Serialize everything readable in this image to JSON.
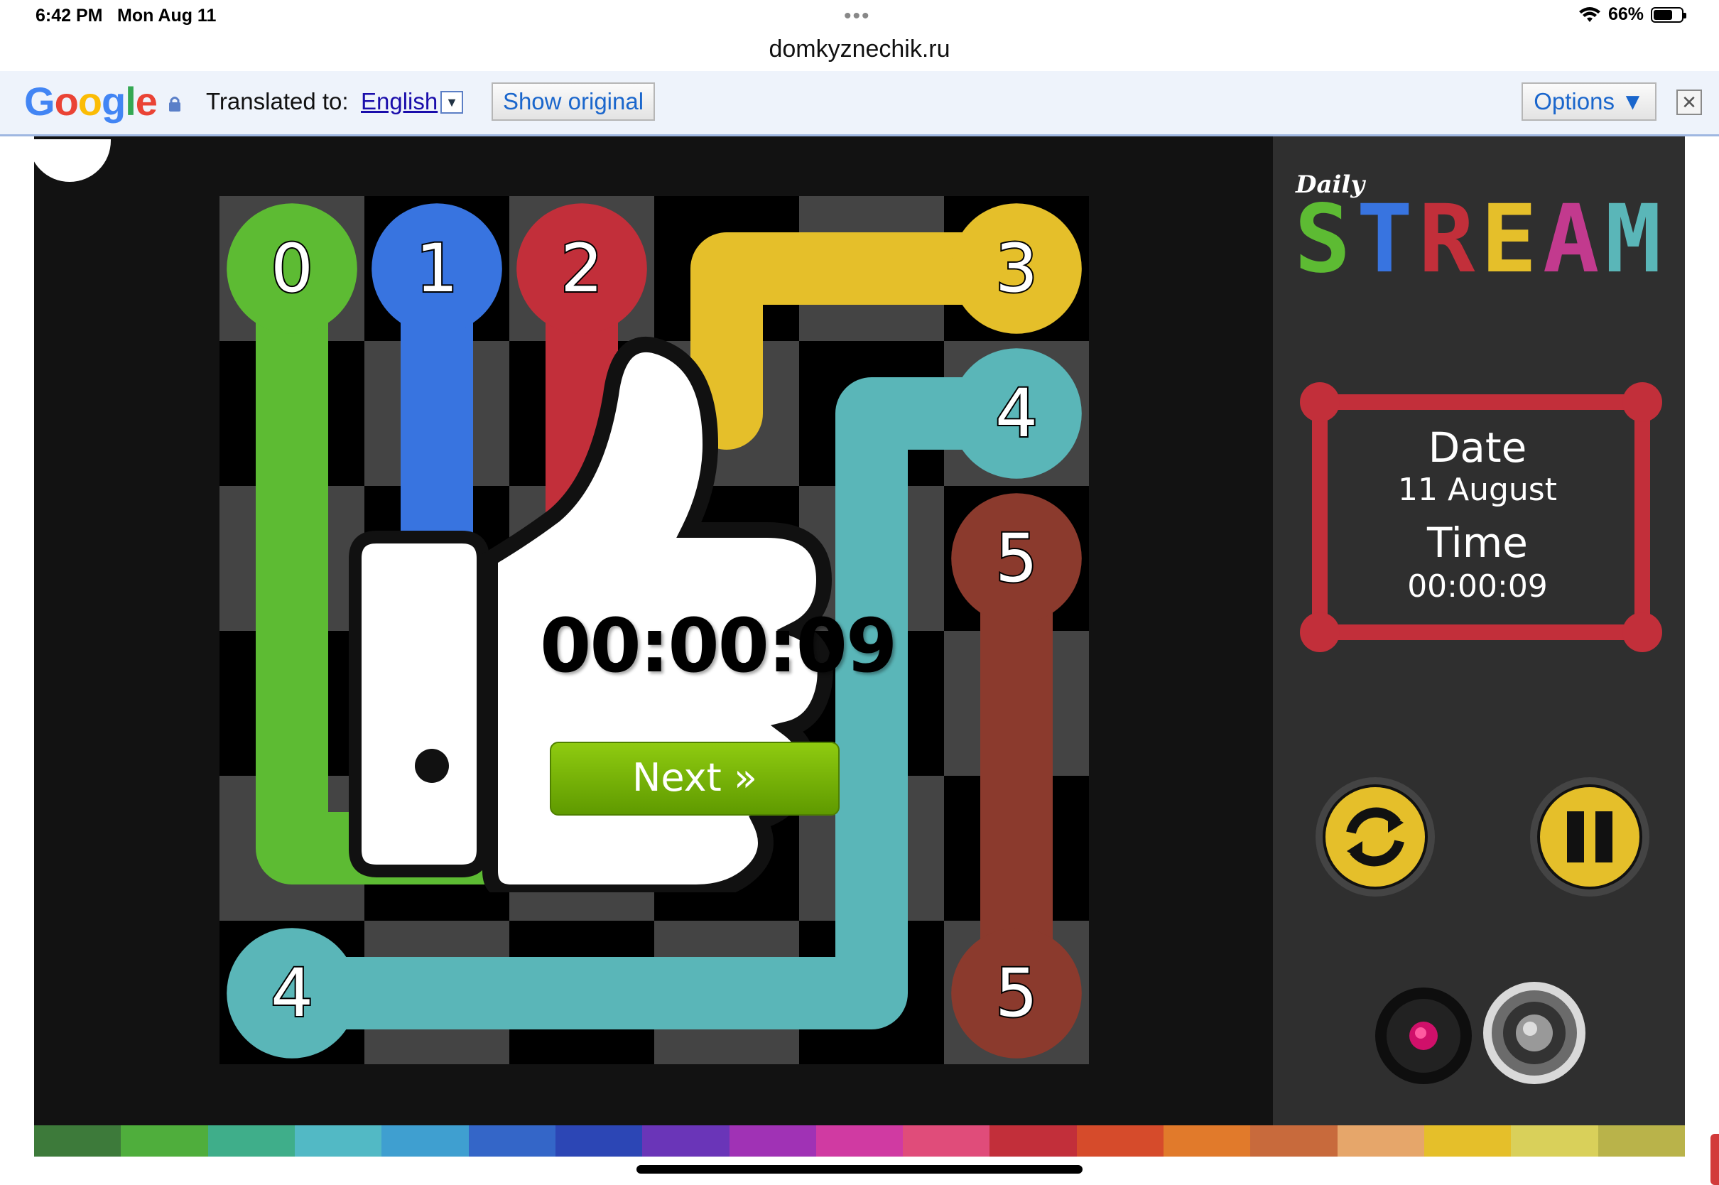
{
  "status_bar": {
    "time": "6:42 PM",
    "date": "Mon Aug 11",
    "battery": "66%",
    "battery_level": 0.66
  },
  "browser": {
    "url": "domkyznechik.ru"
  },
  "translate_bar": {
    "brand": "Google",
    "label": "Translated to:",
    "language": "English",
    "show_original": "Show original",
    "options": "Options ▼",
    "close": "✕"
  },
  "game": {
    "title_small": "Daily",
    "title_big": "STREAM",
    "grid_size": 6,
    "colors": {
      "green": "#5dbb33",
      "blue": "#3874e0",
      "red": "#c22f3a",
      "yellow": "#e5bf2a",
      "teal": "#5ab6b8",
      "brown": "#8b3a2d"
    },
    "endpoints": [
      {
        "label": "0",
        "color": "green"
      },
      {
        "label": "1",
        "color": "blue"
      },
      {
        "label": "2",
        "color": "red"
      },
      {
        "label": "3",
        "color": "yellow"
      },
      {
        "label": "4",
        "color": "teal"
      },
      {
        "label": "5",
        "color": "brown"
      },
      {
        "label": "4",
        "color": "teal"
      },
      {
        "label": "5",
        "color": "brown"
      }
    ],
    "info": {
      "date_label": "Date",
      "date_value": "11 August",
      "time_label": "Time",
      "time_value": "00:00:09"
    },
    "popup": {
      "time": "00:00:09",
      "next_label": "Next »"
    },
    "controls": {
      "restart": "restart-icon",
      "pause": "pause-icon",
      "record": "record-icon",
      "sound": "speaker-icon"
    }
  }
}
